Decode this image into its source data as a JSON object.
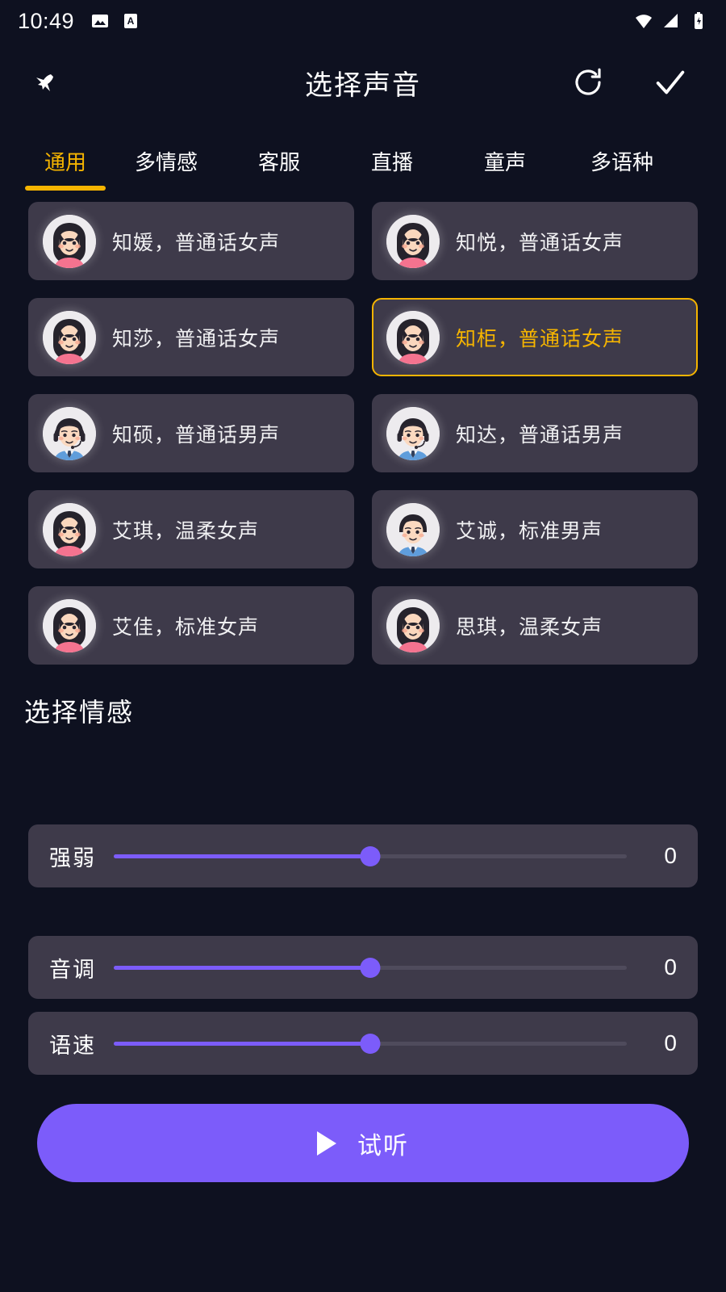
{
  "statusbar": {
    "time": "10:49",
    "left_icons": [
      "image-icon",
      "letter-a-icon"
    ],
    "right_icons": [
      "wifi-icon",
      "signal-icon",
      "battery-charging-icon"
    ]
  },
  "appbar": {
    "title": "选择声音",
    "back_icon": "back-arrow-icon",
    "refresh_icon": "refresh-icon",
    "confirm_icon": "check-icon"
  },
  "tabs": {
    "active_index": 0,
    "items": [
      {
        "label": "通用"
      },
      {
        "label": "多情感"
      },
      {
        "label": "客服"
      },
      {
        "label": "直播"
      },
      {
        "label": "童声"
      },
      {
        "label": "多语种"
      }
    ]
  },
  "voices": [
    {
      "name": "知媛，普通话女声",
      "avatar": "female",
      "selected": false
    },
    {
      "name": "知悦，普通话女声",
      "avatar": "female",
      "selected": false
    },
    {
      "name": "知莎，普通话女声",
      "avatar": "female",
      "selected": false
    },
    {
      "name": "知柜，普通话女声",
      "avatar": "female",
      "selected": true
    },
    {
      "name": "知硕，普通话男声",
      "avatar": "male-headset",
      "selected": false
    },
    {
      "name": "知达，普通话男声",
      "avatar": "male-headset",
      "selected": false
    },
    {
      "name": "艾琪，温柔女声",
      "avatar": "female",
      "selected": false
    },
    {
      "name": "艾诚，标准男声",
      "avatar": "male",
      "selected": false
    },
    {
      "name": "艾佳，标准女声",
      "avatar": "female",
      "selected": false
    },
    {
      "name": "思琪，温柔女声",
      "avatar": "female",
      "selected": false
    }
  ],
  "emotion_section": {
    "title": "选择情感"
  },
  "sliders": [
    {
      "label": "强弱",
      "value": "0",
      "percent": 50
    },
    {
      "label": "音调",
      "value": "0",
      "percent": 50
    },
    {
      "label": "语速",
      "value": "0",
      "percent": 50
    }
  ],
  "preview": {
    "label": "试听",
    "icon": "play-icon"
  },
  "colors": {
    "background": "#0e1120",
    "card": "#3e3a4a",
    "accent_selected": "#f5b400",
    "accent_primary": "#7c5cfa",
    "text": "#ffffff"
  }
}
